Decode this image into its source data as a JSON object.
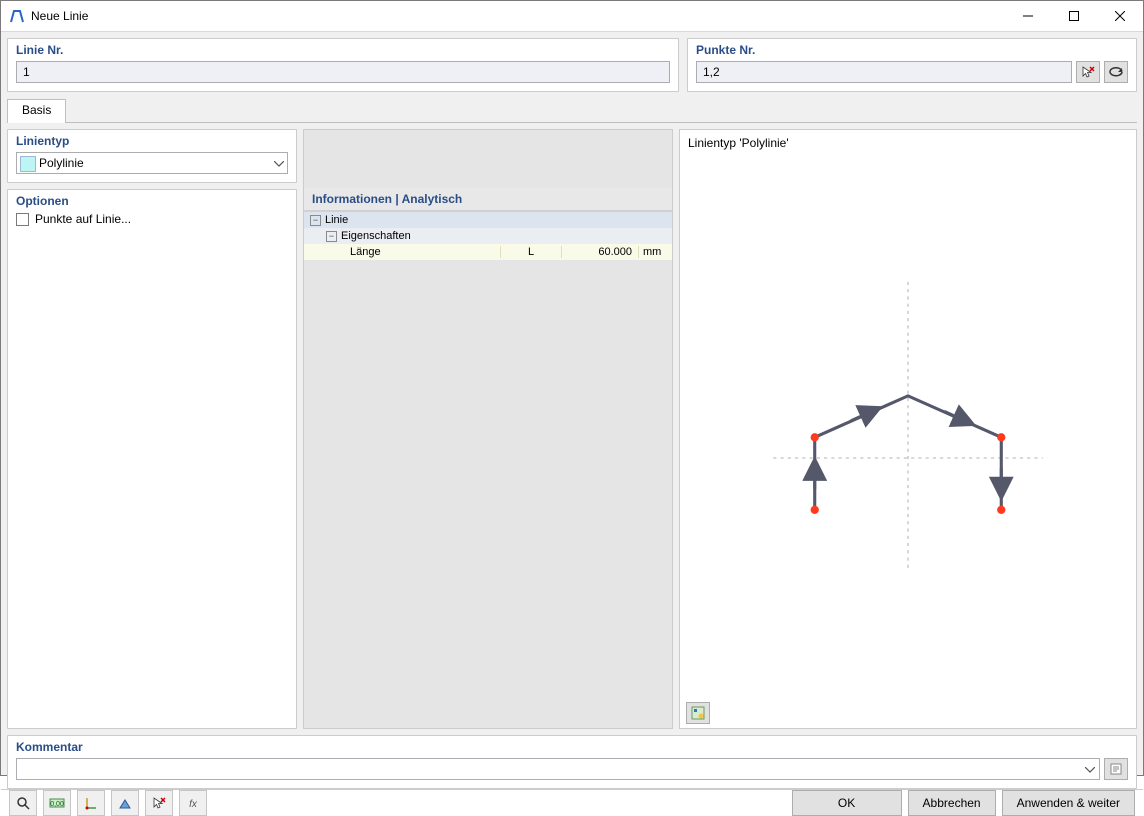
{
  "window": {
    "title": "Neue Linie"
  },
  "linie_nr": {
    "label": "Linie Nr.",
    "value": "1"
  },
  "punkte_nr": {
    "label": "Punkte Nr.",
    "value": "1,2"
  },
  "tabs": {
    "basis": "Basis"
  },
  "linientyp": {
    "label": "Linientyp",
    "selected": "Polylinie"
  },
  "optionen": {
    "label": "Optionen",
    "points_on_line_label": "Punkte auf Linie...",
    "points_on_line_checked": false
  },
  "info": {
    "title": "Informationen | Analytisch",
    "linie_label": "Linie",
    "eigenschaften_label": "Eigenschaften",
    "laenge_label": "Länge",
    "laenge_symbol": "L",
    "laenge_value": "60.000",
    "laenge_unit": "mm"
  },
  "preview": {
    "title": "Linientyp 'Polylinie'"
  },
  "kommentar": {
    "label": "Kommentar",
    "value": ""
  },
  "buttons": {
    "ok": "OK",
    "cancel": "Abbrechen",
    "apply_next": "Anwenden & weiter"
  },
  "colors": {
    "group_title": "#2a4d86"
  }
}
